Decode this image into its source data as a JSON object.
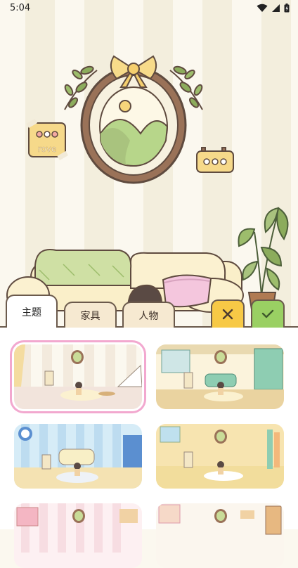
{
  "status_bar": {
    "time": "5:04"
  },
  "scene": {
    "sign_text": "rove"
  },
  "tabs": [
    {
      "label": "主题",
      "active": true
    },
    {
      "label": "家具",
      "active": false
    },
    {
      "label": "人物",
      "active": false
    }
  ],
  "actions": {
    "cancel_icon": "x-icon",
    "confirm_icon": "check-icon"
  },
  "themes": [
    {
      "selected": true
    },
    {
      "selected": false
    },
    {
      "selected": false
    },
    {
      "selected": false
    },
    {
      "selected": false
    },
    {
      "selected": false
    }
  ],
  "colors": {
    "selection": "#f2a8cf",
    "cancel_button": "#f7c946",
    "confirm_button": "#9ad063",
    "tab_bg": "#f6e9d1",
    "outline": "#6b5a4c"
  }
}
